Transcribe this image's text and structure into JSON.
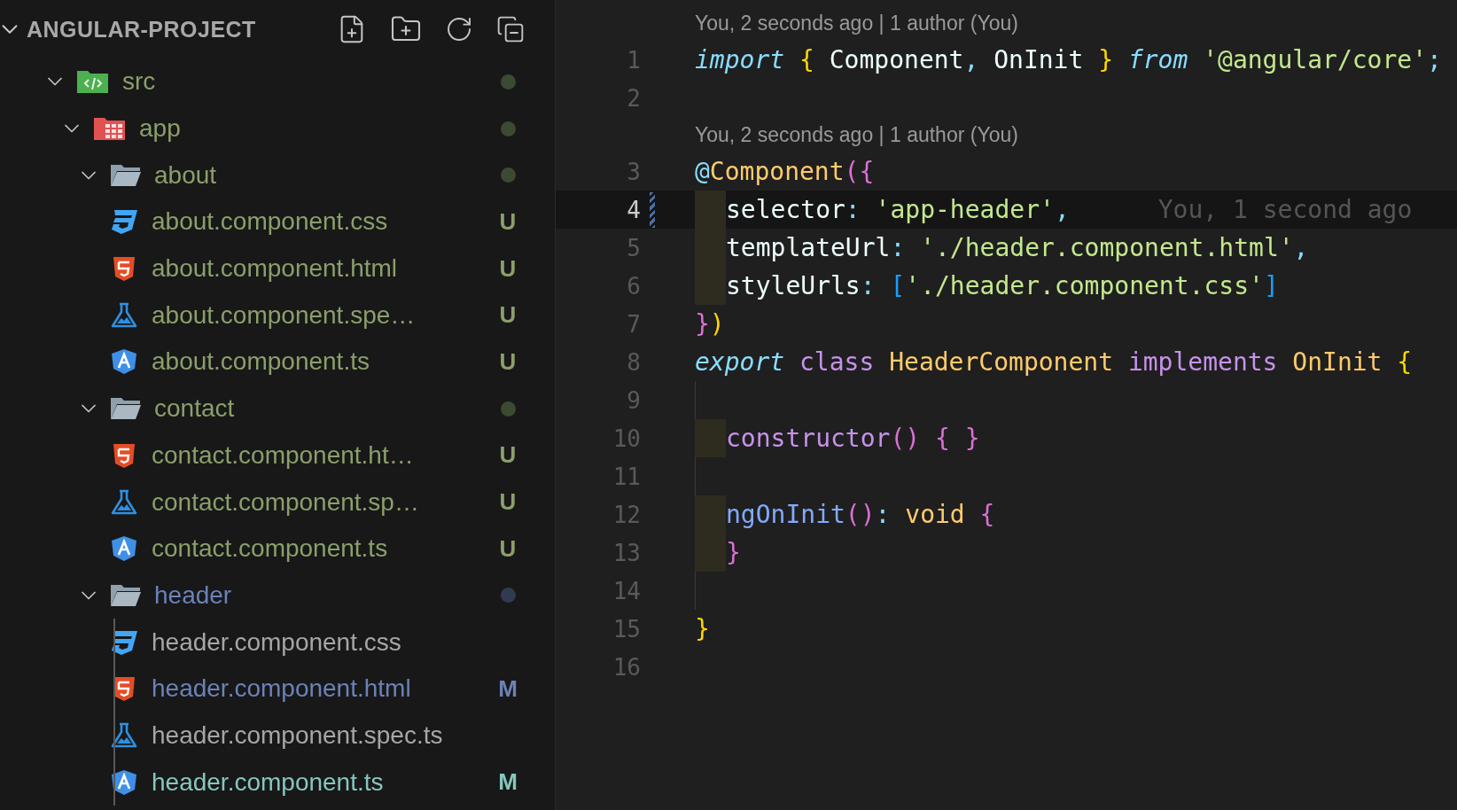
{
  "sidebar": {
    "title": "ANGULAR-PROJECT",
    "expanded": true,
    "tree": [
      {
        "name": "src",
        "kind": "src",
        "expanded": true,
        "modified": false,
        "untracked": true,
        "children": [
          {
            "name": "app",
            "kind": "app",
            "expanded": true,
            "modified": false,
            "untracked": true,
            "children": [
              {
                "name": "about",
                "kind": "folder",
                "expanded": true,
                "modified": false,
                "untracked": true,
                "children": [
                  {
                    "name": "about.component.css",
                    "kind": "css",
                    "modified": false,
                    "untracked": true,
                    "badge": "U",
                    "active": false
                  },
                  {
                    "name": "about.component.html",
                    "kind": "html",
                    "modified": false,
                    "untracked": true,
                    "badge": "U",
                    "active": false
                  },
                  {
                    "name": "about.component.spe…",
                    "kind": "spec",
                    "modified": false,
                    "untracked": true,
                    "badge": "U",
                    "active": false
                  },
                  {
                    "name": "about.component.ts",
                    "kind": "ts",
                    "modified": false,
                    "untracked": true,
                    "badge": "U",
                    "active": false
                  }
                ]
              },
              {
                "name": "contact",
                "kind": "folder",
                "expanded": true,
                "modified": false,
                "untracked": true,
                "children": [
                  {
                    "name": "contact.component.ht…",
                    "kind": "html",
                    "modified": false,
                    "untracked": true,
                    "badge": "U",
                    "active": false
                  },
                  {
                    "name": "contact.component.sp…",
                    "kind": "spec",
                    "modified": false,
                    "untracked": true,
                    "badge": "U",
                    "active": false
                  },
                  {
                    "name": "contact.component.ts",
                    "kind": "ts",
                    "modified": false,
                    "untracked": true,
                    "badge": "U",
                    "active": false
                  }
                ]
              },
              {
                "name": "header",
                "kind": "folder",
                "expanded": true,
                "modified": true,
                "untracked": false,
                "children": [
                  {
                    "name": "header.component.css",
                    "kind": "css",
                    "modified": false,
                    "untracked": false,
                    "active": false
                  },
                  {
                    "name": "header.component.html",
                    "kind": "html",
                    "modified": true,
                    "untracked": false,
                    "badge": "M",
                    "active": false
                  },
                  {
                    "name": "header.component.spec.ts",
                    "kind": "spec",
                    "modified": false,
                    "untracked": false,
                    "active": false
                  },
                  {
                    "name": "header.component.ts",
                    "kind": "ts",
                    "modified": true,
                    "untracked": false,
                    "badge": "M",
                    "active": true
                  }
                ]
              }
            ]
          }
        ]
      }
    ]
  },
  "editor": {
    "lines": [
      {
        "kind": "codelens",
        "text": "You, 2 seconds ago | 1 author (You)"
      },
      {
        "kind": "code",
        "number": "1",
        "current": false,
        "changed": false,
        "tokens": [
          {
            "t": "import ",
            "kind": "keyword"
          },
          {
            "t": "{",
            "kind": "brace1"
          },
          {
            "t": " Component",
            "kind": "plain"
          },
          {
            "t": ",",
            "kind": "punct"
          },
          {
            "t": " OnInit ",
            "kind": "plain"
          },
          {
            "t": "} ",
            "kind": "brace1"
          },
          {
            "t": "from ",
            "kind": "keyword"
          },
          {
            "t": "'@angular/core'",
            "kind": "string"
          },
          {
            "t": ";",
            "kind": "punct"
          }
        ]
      },
      {
        "kind": "code",
        "number": "2",
        "current": false,
        "changed": false
      },
      {
        "kind": "codelens",
        "text": "You, 2 seconds ago | 1 author (You)"
      },
      {
        "kind": "code",
        "number": "3",
        "current": false,
        "changed": false,
        "tokens": [
          {
            "t": "@",
            "kind": "punct"
          },
          {
            "t": "Component",
            "kind": "entity"
          },
          {
            "t": "(",
            "kind": "brace2"
          },
          {
            "t": "{",
            "kind": "brace2"
          }
        ]
      },
      {
        "kind": "code",
        "number": "4",
        "current": true,
        "changed": true,
        "indent_marked": true,
        "annotation": "You, 1 second ago",
        "tokens": [
          {
            "t": "selector",
            "kind": "plain"
          },
          {
            "t": ": ",
            "kind": "punct"
          },
          {
            "t": "'app-header'",
            "kind": "string"
          },
          {
            "t": ",",
            "kind": "punct"
          }
        ]
      },
      {
        "kind": "code",
        "number": "5",
        "current": false,
        "changed": false,
        "indent_marked": true,
        "tokens": [
          {
            "t": "templateUrl",
            "kind": "plain"
          },
          {
            "t": ": ",
            "kind": "punct"
          },
          {
            "t": "'./header.component.html'",
            "kind": "string"
          },
          {
            "t": ",",
            "kind": "punct"
          }
        ]
      },
      {
        "kind": "code",
        "number": "6",
        "current": false,
        "changed": false,
        "indent_marked": true,
        "tokens": [
          {
            "t": "styleUrls",
            "kind": "plain"
          },
          {
            "t": ": ",
            "kind": "punct"
          },
          {
            "t": "[",
            "kind": "brace3"
          },
          {
            "t": "'./header.component.css'",
            "kind": "string"
          },
          {
            "t": "]",
            "kind": "brace3"
          }
        ]
      },
      {
        "kind": "code",
        "number": "7",
        "current": false,
        "changed": false,
        "tokens": [
          {
            "t": "}",
            "kind": "brace2"
          },
          {
            "t": ")",
            "kind": "brace1"
          }
        ]
      },
      {
        "kind": "code",
        "number": "8",
        "current": false,
        "changed": false,
        "tokens": [
          {
            "t": "export ",
            "kind": "keyword"
          },
          {
            "t": "class ",
            "kind": "storage"
          },
          {
            "t": "HeaderComponent ",
            "kind": "entity"
          },
          {
            "t": "implements ",
            "kind": "storage"
          },
          {
            "t": "OnInit ",
            "kind": "entity"
          },
          {
            "t": "{",
            "kind": "brace1"
          }
        ]
      },
      {
        "kind": "code",
        "number": "9",
        "current": false,
        "changed": false,
        "indent_marked": false
      },
      {
        "kind": "code",
        "number": "10",
        "current": false,
        "changed": false,
        "indent_marked": true,
        "tokens": [
          {
            "t": "constructor",
            "kind": "storage"
          },
          {
            "t": "() { }",
            "kind": "brace2"
          }
        ]
      },
      {
        "kind": "code",
        "number": "11",
        "current": false,
        "changed": false,
        "indent_marked": false
      },
      {
        "kind": "code",
        "number": "12",
        "current": false,
        "changed": false,
        "indent_marked": true,
        "tokens": [
          {
            "t": "ngOnInit",
            "kind": "func"
          },
          {
            "t": "()",
            "kind": "brace2"
          },
          {
            "t": ": ",
            "kind": "punct"
          },
          {
            "t": "void ",
            "kind": "entity"
          },
          {
            "t": "{",
            "kind": "brace2"
          }
        ]
      },
      {
        "kind": "code",
        "number": "13",
        "current": false,
        "changed": false,
        "indent_marked": true,
        "tokens": [
          {
            "t": "}",
            "kind": "brace2"
          }
        ]
      },
      {
        "kind": "code",
        "number": "14",
        "current": false,
        "changed": false,
        "indent_marked": false
      },
      {
        "kind": "code",
        "number": "15",
        "current": false,
        "changed": false,
        "tokens": [
          {
            "t": "}",
            "kind": "brace1"
          }
        ]
      },
      {
        "kind": "code",
        "number": "16",
        "current": false,
        "changed": false
      }
    ]
  }
}
